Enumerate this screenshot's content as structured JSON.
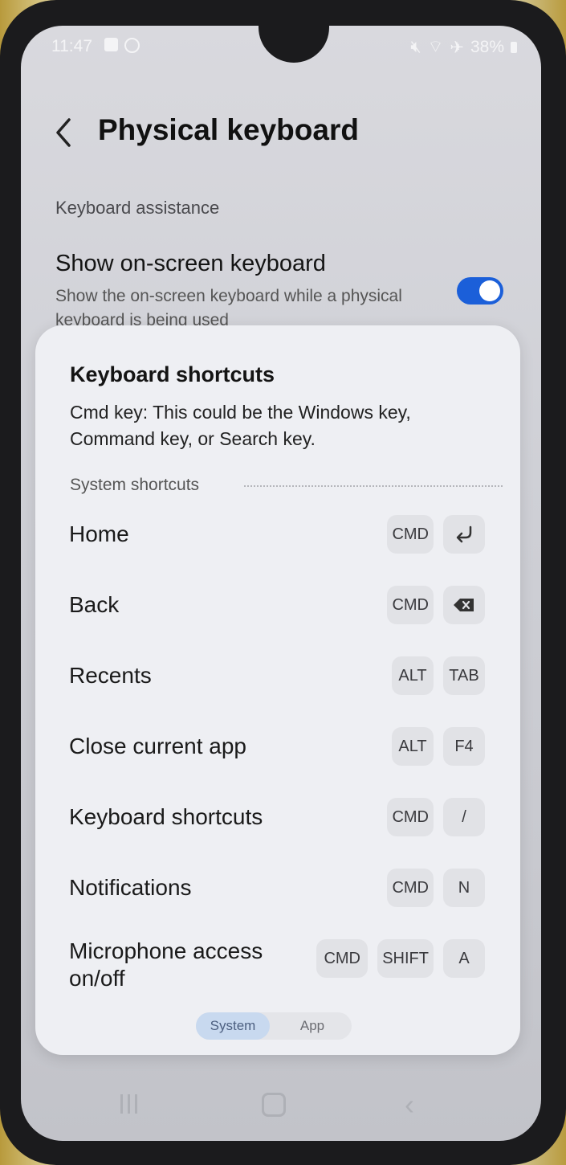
{
  "status_bar": {
    "time": "11:47",
    "battery": "38%",
    "left_icons": [
      "notification-square-icon",
      "circle-app-icon"
    ],
    "right_icons": [
      "mute-icon",
      "wifi-icon",
      "airplane-icon",
      "battery-icon"
    ]
  },
  "header": {
    "title": "Physical keyboard",
    "back_icon": "chevron-left-icon"
  },
  "settings": {
    "section_title": "Keyboard assistance",
    "show_onscreen": {
      "title": "Show on-screen keyboard",
      "subtitle": "Show the on-screen keyboard while a physical keyboard is being used",
      "enabled": true
    }
  },
  "dialog": {
    "title": "Keyboard shortcuts",
    "description": "Cmd key: This could be the Windows key, Command key, or Search key.",
    "section": "System shortcuts",
    "shortcuts": [
      {
        "label": "Home",
        "keys": [
          "CMD",
          "↵"
        ]
      },
      {
        "label": "Back",
        "keys": [
          "CMD",
          "⌫"
        ]
      },
      {
        "label": "Recents",
        "keys": [
          "ALT",
          "TAB"
        ]
      },
      {
        "label": "Close current app",
        "keys": [
          "ALT",
          "F4"
        ]
      },
      {
        "label": "Keyboard shortcuts",
        "keys": [
          "CMD",
          "/"
        ]
      },
      {
        "label": "Notifications",
        "keys": [
          "CMD",
          "N"
        ]
      },
      {
        "label": "Microphone access on/off",
        "keys": [
          "CMD",
          "SHIFT",
          "A"
        ]
      }
    ],
    "tabs": [
      {
        "label": "System",
        "selected": true
      },
      {
        "label": "App",
        "selected": false
      }
    ]
  },
  "nav_bar": {
    "icons": [
      "recents-icon",
      "home-icon",
      "back-icon"
    ]
  },
  "colors": {
    "accent": "#1b5fd9",
    "dialog_bg": "#eeeff3",
    "key_bg": "#e1e2e6"
  }
}
